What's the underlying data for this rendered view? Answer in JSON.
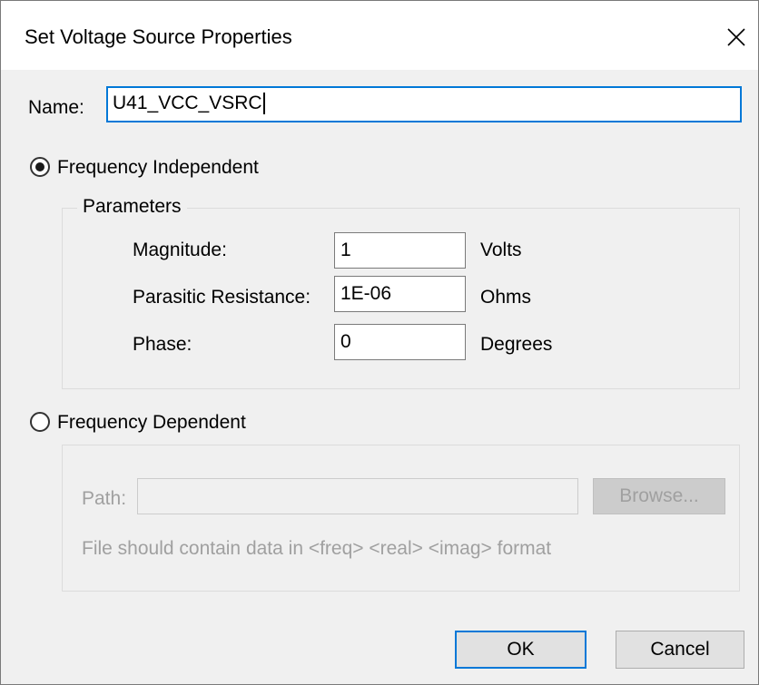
{
  "window": {
    "title": "Set Voltage Source Properties",
    "close_icon": "close-icon"
  },
  "name_field": {
    "label": "Name:",
    "value": "U41_VCC_VSRC"
  },
  "freq_independent": {
    "label": "Frequency Independent",
    "selected": true,
    "group_title": "Parameters",
    "params": {
      "magnitude": {
        "label": "Magnitude:",
        "value": "1",
        "unit": "Volts"
      },
      "resistance": {
        "label": "Parasitic Resistance:",
        "value": "1E-06",
        "unit": "Ohms"
      },
      "phase": {
        "label": "Phase:",
        "value": "0",
        "unit": "Degrees"
      }
    }
  },
  "freq_dependent": {
    "label": "Frequency Dependent",
    "selected": false,
    "path_label": "Path:",
    "path_value": "",
    "browse_label": "Browse...",
    "hint": "File should contain data in <freq> <real> <imag> format"
  },
  "buttons": {
    "ok": "OK",
    "cancel": "Cancel"
  },
  "colors": {
    "accent": "#0078d7",
    "dialog_bg": "#f0f0f0",
    "disabled_text": "#a0a0a0"
  }
}
